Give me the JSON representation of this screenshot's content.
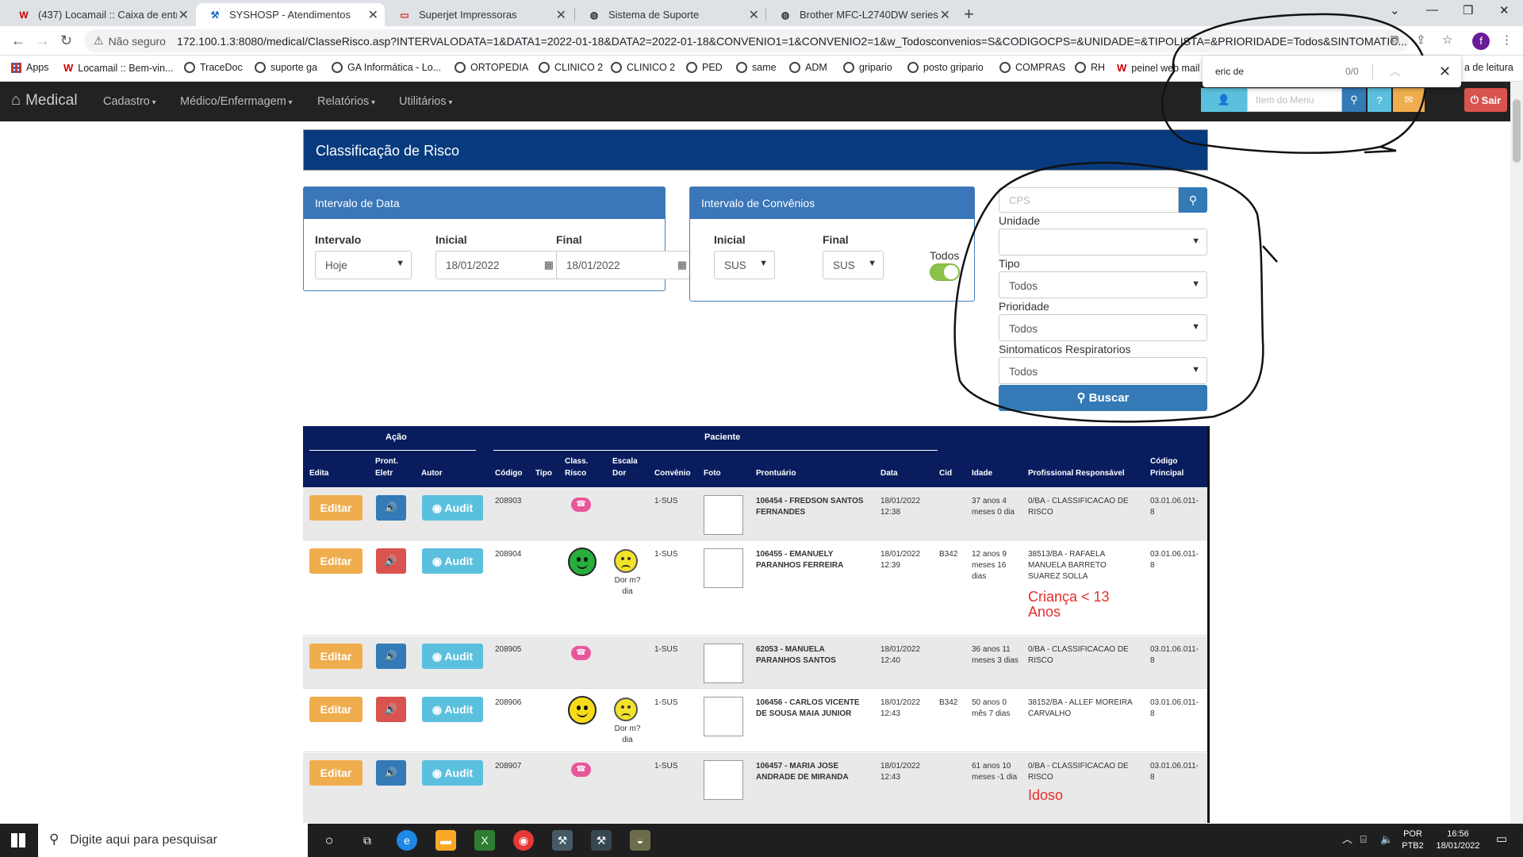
{
  "browser": {
    "tabs": [
      {
        "label": "(437) Locamail :: Caixa de entrada",
        "icon": "W"
      },
      {
        "label": "SYSHOSP - Atendimentos",
        "icon": "tool"
      },
      {
        "label": "Superjet Impressoras",
        "icon": "chat"
      },
      {
        "label": "Sistema de Suporte",
        "icon": "globe"
      },
      {
        "label": "Brother MFC-L2740DW series",
        "icon": "globe"
      }
    ],
    "security": "Não seguro",
    "url": "172.100.1.3:8080/medical/ClasseRisco.asp?INTERVALODATA=1&DATA1=2022-01-18&DATA2=2022-01-18&CONVENIO1=1&CONVENIO2=1&w_Todosconvenios=S&CODIGOCPS=&UNIDADE=&TIPOLISTA=&PRIORIDADE=Todos&SINTOMATIC...",
    "bookmarks": [
      "Apps",
      "Locamail :: Bem-vin...",
      "TraceDoc",
      "suporte ga",
      "GA Informática - Lo...",
      "ORTOPEDIA",
      "CLINICO 2",
      "CLINICO 2",
      "PED",
      "same",
      "ADM",
      "gripario",
      "posto gripario",
      "COMPRAS",
      "RH",
      "peinel web mail",
      "a de leitura"
    ],
    "find": {
      "query": "eric de",
      "count": "0/0"
    }
  },
  "app": {
    "brand": "Medical",
    "menu": [
      "Cadastro",
      "Médico/Enfermagem",
      "Relatórios",
      "Utilitários"
    ],
    "menu_search_placeholder": "Item do Menu",
    "logout": "Sair"
  },
  "page": {
    "title": "Classificação de Risco",
    "date_box": {
      "title": "Intervalo de Data",
      "interval_label": "Intervalo",
      "interval_value": "Hoje",
      "start_label": "Inicial",
      "start_value": "18/01/2022",
      "end_label": "Final",
      "end_value": "18/01/2022"
    },
    "conv_box": {
      "title": "Intervalo de Convênios",
      "start_label": "Inicial",
      "start_value": "SUS",
      "end_label": "Final",
      "end_value": "SUS",
      "all_label": "Todos",
      "all_on": true
    },
    "filters": {
      "cps_placeholder": "CPS",
      "unidade_label": "Unidade",
      "unidade_value": "",
      "tipo_label": "Tipo",
      "tipo_value": "Todos",
      "prioridade_label": "Prioridade",
      "prioridade_value": "Todos",
      "sintomaticos_label": "Sintomaticos Respiratorios",
      "sintomaticos_value": "Todos",
      "search_button": "Buscar"
    },
    "table": {
      "group_acao": "Ação",
      "group_paciente": "Paciente",
      "columns": {
        "edita": "Edita",
        "prontl1": "Pront.",
        "prontl2": "Eletr",
        "autor": "Autor",
        "codigo": "Código",
        "tipo": "Tipo",
        "classl1": "Class.",
        "classl2": "Risco",
        "escalal1": "Escala",
        "escalal2": "Dor",
        "convenio": "Convênio",
        "foto": "Foto",
        "prontuario": "Prontuário",
        "data": "Data",
        "cid": "Cid",
        "idade": "Idade",
        "profissional": "Profissional Responsável",
        "codl1": "Código",
        "codl2": "Principal"
      },
      "edit_label": "Editar",
      "audit_label": "Audit",
      "rows": [
        {
          "codigo": "208903",
          "risk": "none",
          "pain": "",
          "convenio": "1-SUS",
          "pront_id": "106454",
          "pront_name": "FREDSON SANTOS FERNANDES",
          "data1": "18/01/2022",
          "data2": "12:38",
          "cid": "",
          "idade": "37 anos 4 meses 0 dia",
          "prof": "0/BA - CLASSIFICACAO DE RISCO",
          "cod": "03.01.06.011-8",
          "alert": "",
          "sound": "blue"
        },
        {
          "codigo": "208904",
          "risk": "green",
          "pain": "Dor m? dia",
          "convenio": "1-SUS",
          "pront_id": "106455",
          "pront_name": "EMANUELY PARANHOS FERREIRA",
          "data1": "18/01/2022",
          "data2": "12:39",
          "cid": "B342",
          "idade": "12 anos 9 meses 16 dias",
          "prof": "38513/BA - RAFAELA MANUELA BARRETO SUAREZ SOLLA",
          "cod": "03.01.06.011-8",
          "alert": "Criança < 13 Anos",
          "sound": "red"
        },
        {
          "codigo": "208905",
          "risk": "none",
          "pain": "",
          "convenio": "1-SUS",
          "pront_id": "62053",
          "pront_name": "MANUELA PARANHOS SANTOS",
          "data1": "18/01/2022",
          "data2": "12:40",
          "cid": "",
          "idade": "36 anos 11 meses 3 dias",
          "prof": "0/BA - CLASSIFICACAO DE RISCO",
          "cod": "03.01.06.011-8",
          "alert": "",
          "sound": "blue"
        },
        {
          "codigo": "208906",
          "risk": "yellow",
          "pain": "Dor m? dia",
          "convenio": "1-SUS",
          "pront_id": "106456",
          "pront_name": "CARLOS VICENTE DE SOUSA MAIA JUNIOR",
          "data1": "18/01/2022",
          "data2": "12:43",
          "cid": "B342",
          "idade": "50 anos 0 mês 7 dias",
          "prof": "38152/BA - ALLEF MOREIRA CARVALHO",
          "cod": "03.01.06.011-8",
          "alert": "",
          "sound": "red"
        },
        {
          "codigo": "208907",
          "risk": "none",
          "pain": "",
          "convenio": "1-SUS",
          "pront_id": "106457",
          "pront_name": "MARIA JOSE ANDRADE DE MIRANDA",
          "data1": "18/01/2022",
          "data2": "12:43",
          "cid": "",
          "idade": "61 anos 10 meses -1 dia",
          "prof": "0/BA - CLASSIFICACAO DE RISCO",
          "cod": "03.01.06.011-8",
          "alert": "Idoso",
          "sound": "blue"
        }
      ]
    }
  },
  "taskbar": {
    "search_placeholder": "Digite aqui para pesquisar",
    "lang1": "POR",
    "lang2": "PTB2",
    "time": "16:56",
    "date": "18/01/2022"
  }
}
